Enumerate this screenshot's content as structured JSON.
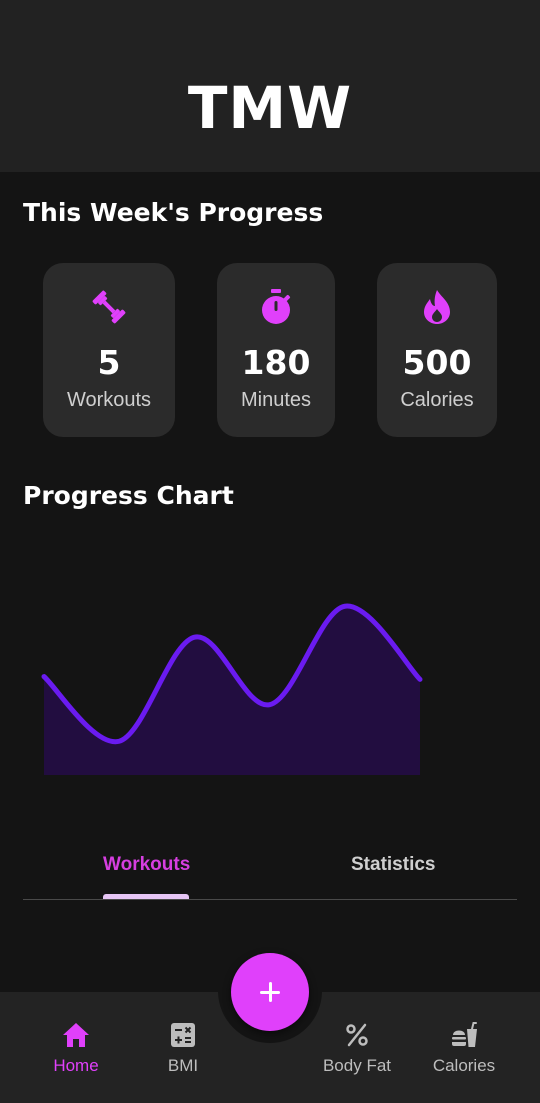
{
  "app": {
    "title": "TMW"
  },
  "week": {
    "title": "This Week's Progress",
    "cards": [
      {
        "value": "5",
        "label": "Workouts",
        "icon": "dumbbell-icon"
      },
      {
        "value": "180",
        "label": "Minutes",
        "icon": "stopwatch-icon"
      },
      {
        "value": "500",
        "label": "Calories",
        "icon": "fire-icon"
      }
    ]
  },
  "chart_section": {
    "title": "Progress Chart"
  },
  "chart_data": {
    "type": "area",
    "title": "",
    "xlabel": "",
    "ylabel": "",
    "x": [
      0,
      1,
      2,
      3,
      4,
      5,
      6
    ],
    "series": [
      {
        "values": [
          3.5,
          1.2,
          4.9,
          2.5,
          6.0,
          3.4
        ]
      }
    ],
    "ylim": [
      0,
      8
    ],
    "grid": false,
    "line_color": "#6a1bf0",
    "fill_color": "#220d40"
  },
  "tabs": {
    "items": [
      "Workouts",
      "Statistics"
    ],
    "active": "Workouts"
  },
  "fab": {
    "icon": "plus-icon"
  },
  "nav": {
    "items": [
      {
        "label": "Home",
        "icon": "home-icon",
        "active": true
      },
      {
        "label": "BMI",
        "icon": "calculator-icon",
        "active": false
      },
      {
        "label": "Body Fat",
        "icon": "percent-icon",
        "active": false
      },
      {
        "label": "Calories",
        "icon": "fastfood-icon",
        "active": false
      }
    ]
  },
  "colors": {
    "accent": "#e040fb",
    "background": "#141414",
    "card": "#2b2b2b",
    "appbar": "#222222"
  }
}
